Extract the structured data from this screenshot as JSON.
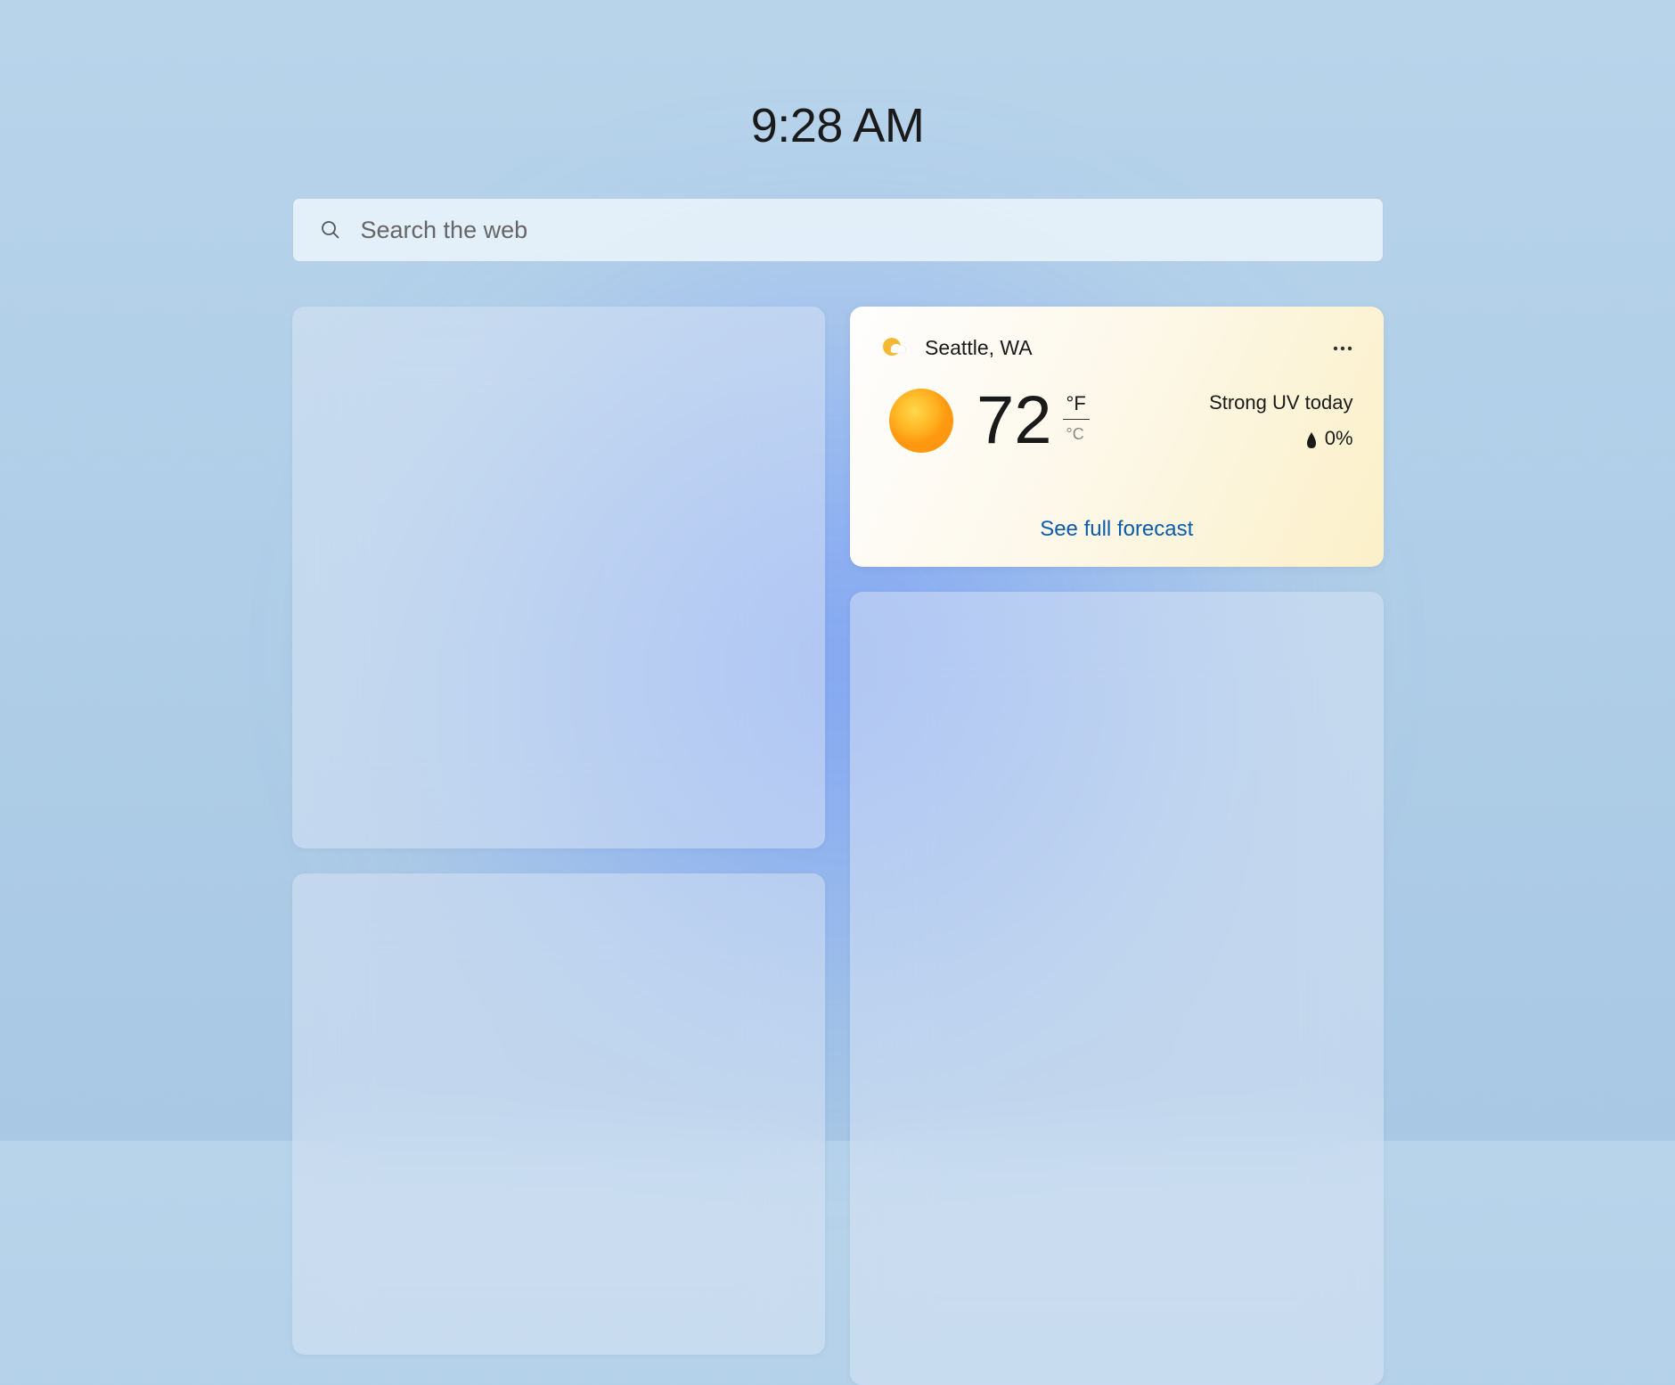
{
  "header": {
    "time": "9:28 AM"
  },
  "search": {
    "placeholder": "Search the web"
  },
  "weather": {
    "location": "Seattle, WA",
    "temperature": "72",
    "unit_f": "°F",
    "unit_c": "°C",
    "uv_text": "Strong UV today",
    "precipitation": "0%",
    "forecast_link": "See full forecast"
  },
  "icons": {
    "search": "search-icon",
    "more": "more-options-icon",
    "weather_app": "weather-app-icon",
    "sun": "sun-icon",
    "drop": "water-drop-icon"
  }
}
